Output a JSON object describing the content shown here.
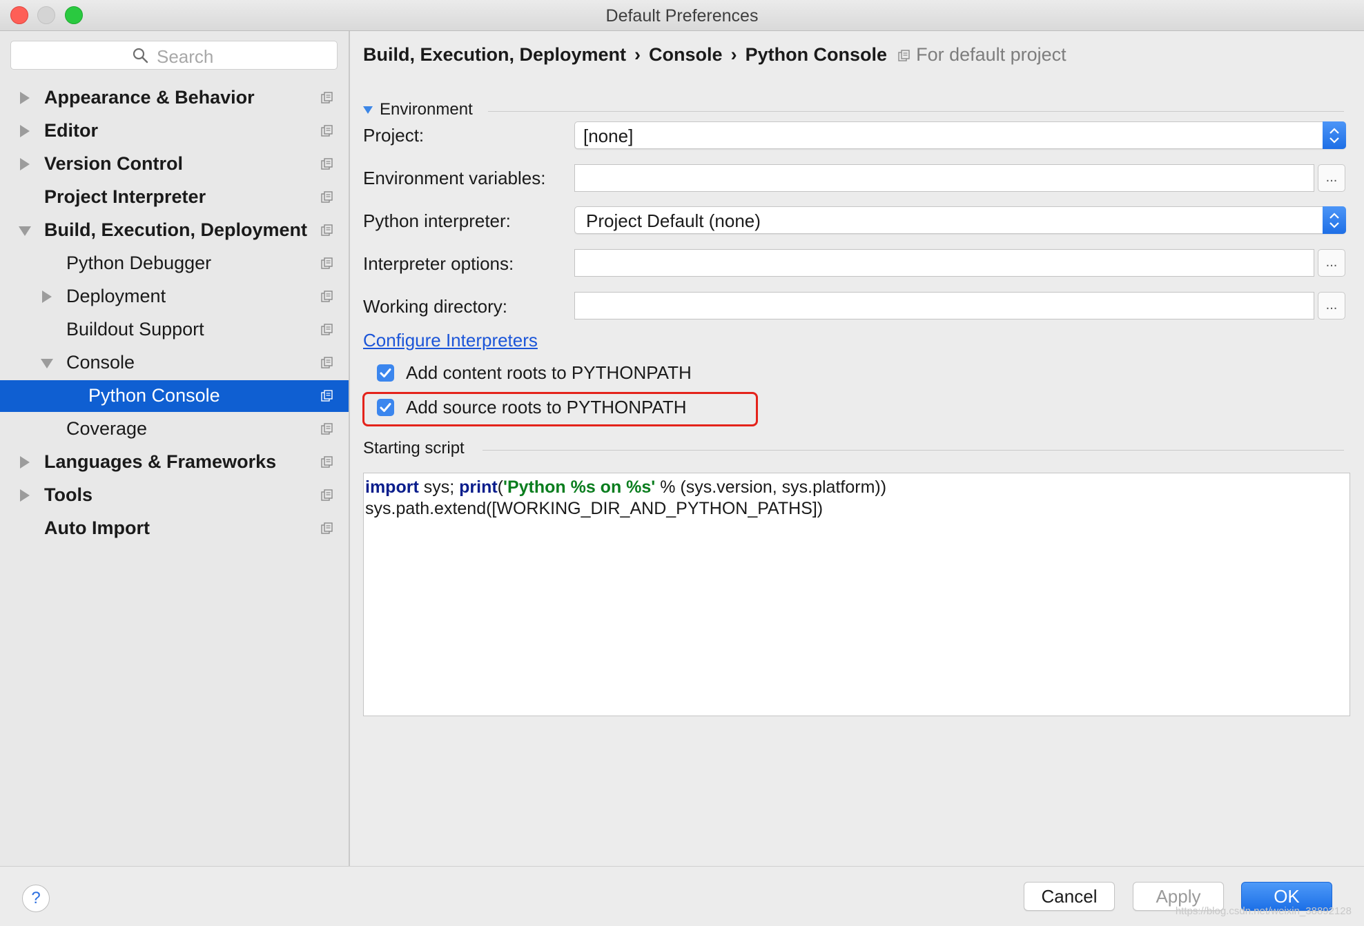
{
  "window": {
    "title": "Default Preferences"
  },
  "sidebar": {
    "search_placeholder": "Search",
    "items": [
      {
        "label": "Appearance & Behavior",
        "bold": true,
        "expander": "collapsed",
        "level": 0
      },
      {
        "label": "Editor",
        "bold": true,
        "expander": "collapsed",
        "level": 0
      },
      {
        "label": "Version Control",
        "bold": true,
        "expander": "collapsed",
        "level": 0
      },
      {
        "label": "Project Interpreter",
        "bold": true,
        "expander": "none",
        "level": 0
      },
      {
        "label": "Build, Execution, Deployment",
        "bold": true,
        "expander": "expanded",
        "level": 0
      },
      {
        "label": "Python Debugger",
        "bold": false,
        "expander": "none",
        "level": 1
      },
      {
        "label": "Deployment",
        "bold": false,
        "expander": "collapsed",
        "level": 1
      },
      {
        "label": "Buildout Support",
        "bold": false,
        "expander": "none",
        "level": 1
      },
      {
        "label": "Console",
        "bold": false,
        "expander": "expanded",
        "level": 1
      },
      {
        "label": "Python Console",
        "bold": false,
        "expander": "none",
        "level": 2,
        "selected": true
      },
      {
        "label": "Coverage",
        "bold": false,
        "expander": "none",
        "level": 1
      },
      {
        "label": "Languages & Frameworks",
        "bold": true,
        "expander": "collapsed",
        "level": 0
      },
      {
        "label": "Tools",
        "bold": true,
        "expander": "collapsed",
        "level": 0
      },
      {
        "label": "Auto Import",
        "bold": true,
        "expander": "none",
        "level": 0
      }
    ]
  },
  "breadcrumb": {
    "parts": [
      "Build, Execution, Deployment",
      "Console",
      "Python Console"
    ],
    "separator": "›",
    "hint": "For default project"
  },
  "environment": {
    "section_title": "Environment",
    "project_label": "Project:",
    "project_value": "[none]",
    "env_vars_label": "Environment variables:",
    "env_vars_value": "",
    "interpreter_label": "Python interpreter:",
    "interpreter_value": "Project Default (none)",
    "interp_options_label": "Interpreter options:",
    "interp_options_value": "",
    "working_dir_label": "Working directory:",
    "working_dir_value": "",
    "browse_label": "...",
    "configure_link": "Configure Interpreters",
    "content_roots_label": "Add content roots to PYTHONPATH",
    "content_roots_checked": true,
    "source_roots_label": "Add source roots to PYTHONPATH",
    "source_roots_checked": true
  },
  "starting_script": {
    "section_title": "Starting script",
    "line1": {
      "kw_import": "import",
      "part_a": " sys; ",
      "kw_print": "print",
      "part_b": "(",
      "string": "'Python %s on %s'",
      "part_c": " % (sys.version, sys.platform))"
    },
    "line2": "sys.path.extend([WORKING_DIR_AND_PYTHON_PATHS])"
  },
  "buttons": {
    "help": "?",
    "cancel": "Cancel",
    "apply": "Apply",
    "ok": "OK"
  },
  "watermark": "https://blog.csdn.net/weixin_38892128",
  "colors": {
    "accent": "#0f5fd2",
    "link": "#1b55d8",
    "highlight": "#e4231b",
    "keyword": "#0a1d8c",
    "string": "#0a7d1e"
  }
}
